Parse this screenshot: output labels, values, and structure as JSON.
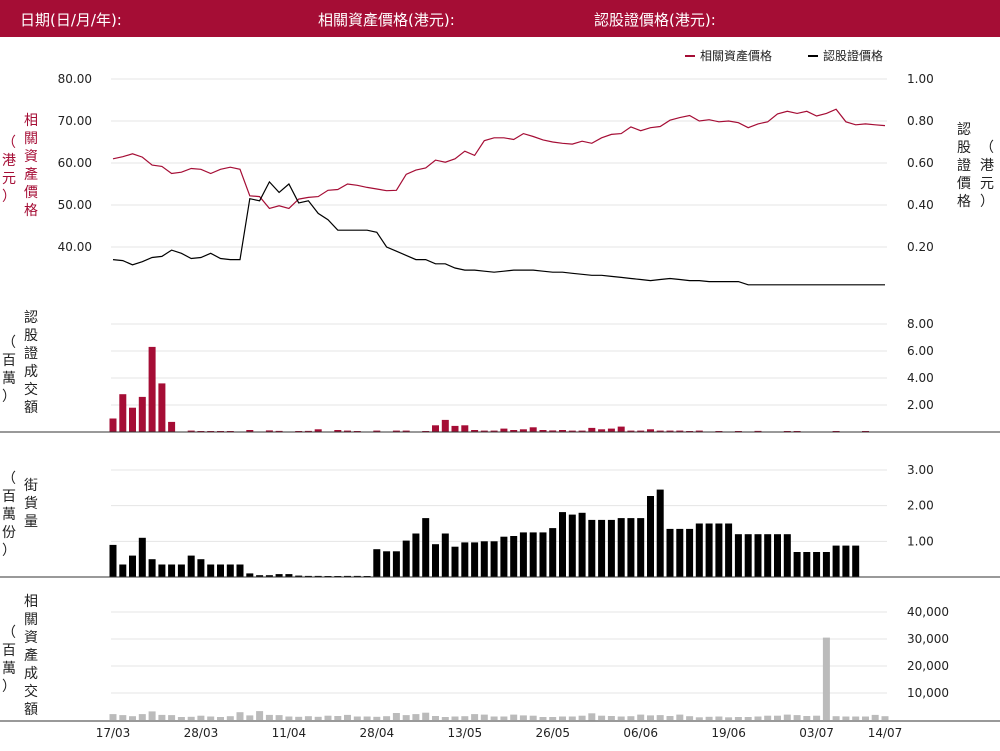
{
  "header": {
    "date_label": "日期(日/月/年):",
    "underlying_price_label": "相關資產價格(港元):",
    "warrant_price_label": "認股證價格(港元):"
  },
  "colors": {
    "header_bg": "#a50d35",
    "underlying": "#a50d35",
    "warrant": "#000000",
    "underlying_turnover": "#bbbbbb"
  },
  "chart_data": [
    {
      "type": "line",
      "legend": [
        "相關資產價格",
        "認股證價格"
      ],
      "legend_position": "top-right",
      "left_axis_label": [
        "相",
        "關",
        "資",
        "產",
        "價",
        "格"
      ],
      "left_axis_unit": [
        "（",
        "港",
        "元",
        "）"
      ],
      "right_axis_label": [
        "認",
        "股",
        "證",
        "價",
        "格"
      ],
      "right_axis_unit": [
        "（",
        "港",
        "元",
        "）"
      ],
      "left_ticks": [
        "80.00",
        "70.00",
        "60.00",
        "50.00",
        "40.00"
      ],
      "right_ticks": [
        "1.00",
        "0.80",
        "0.60",
        "0.40",
        "0.20"
      ],
      "left_ylim": [
        33.5,
        80
      ],
      "right_ylim": [
        0.01,
        1.0
      ],
      "x_count": 80,
      "series": [
        {
          "name": "相關資產價格",
          "axis": "left",
          "values": [
            61,
            61.5,
            62.2,
            61.4,
            59.5,
            59.2,
            57.5,
            57.8,
            58.7,
            58.5,
            57.5,
            58.5,
            59,
            58.5,
            52.2,
            52,
            49.2,
            49.8,
            49.2,
            51.4,
            51.8,
            52,
            53.5,
            53.7,
            55,
            54.7,
            54.2,
            53.8,
            53.4,
            53.5,
            57.3,
            58.3,
            58.8,
            60.7,
            60.2,
            61,
            62.8,
            61.8,
            65.3,
            66,
            66,
            65.6,
            67,
            66.3,
            65.5,
            65,
            64.7,
            64.5,
            65.2,
            64.7,
            66,
            66.8,
            67,
            68.6,
            67.7,
            68.4,
            68.7,
            70.2,
            70.8,
            71.3,
            70,
            70.3,
            69.8,
            70,
            69.6,
            68.4,
            69.3,
            69.8,
            71.7,
            72.3,
            71.8,
            72.3,
            71.2,
            71.8,
            72.8,
            69.8,
            69.1,
            69.3,
            69.1,
            68.9
          ]
        },
        {
          "name": "認股證價格",
          "axis": "right",
          "values": [
            0.14,
            0.135,
            0.115,
            0.13,
            0.15,
            0.155,
            0.185,
            0.17,
            0.145,
            0.15,
            0.17,
            0.145,
            0.14,
            0.14,
            0.43,
            0.42,
            0.51,
            0.46,
            0.5,
            0.41,
            0.42,
            0.36,
            0.33,
            0.28,
            0.28,
            0.28,
            0.28,
            0.27,
            0.2,
            0.18,
            0.16,
            0.14,
            0.14,
            0.12,
            0.12,
            0.1,
            0.09,
            0.09,
            0.085,
            0.08,
            0.085,
            0.09,
            0.09,
            0.09,
            0.085,
            0.08,
            0.08,
            0.075,
            0.07,
            0.065,
            0.065,
            0.06,
            0.055,
            0.05,
            0.045,
            0.04,
            0.045,
            0.05,
            0.045,
            0.04,
            0.04,
            0.035,
            0.035,
            0.035,
            0.035,
            0.02,
            0.02,
            0.02,
            0.02,
            0.02,
            0.02,
            0.02,
            0.02,
            0.02,
            0.02,
            0.02,
            0.02,
            0.02,
            0.02,
            0.02
          ]
        }
      ]
    },
    {
      "type": "bar",
      "axis_label": [
        "認",
        "股",
        "證",
        "成",
        "交",
        "額"
      ],
      "axis_unit": [
        "（",
        "百",
        "萬",
        "）"
      ],
      "ticks": [
        "8.00",
        "6.00",
        "4.00",
        "2.00"
      ],
      "ylim": [
        0,
        8.5
      ],
      "color": "#a50d35",
      "values": [
        1.0,
        2.8,
        1.8,
        2.6,
        6.3,
        3.6,
        0.75,
        0,
        0.1,
        0.05,
        0.05,
        0.05,
        0.05,
        0,
        0.15,
        0,
        0.12,
        0.08,
        0,
        0.05,
        0.08,
        0.2,
        0,
        0.15,
        0.1,
        0.05,
        0,
        0.1,
        0,
        0.1,
        0.1,
        0,
        0.05,
        0.5,
        0.9,
        0.45,
        0.5,
        0.15,
        0.1,
        0.1,
        0.25,
        0.15,
        0.2,
        0.35,
        0.15,
        0.12,
        0.15,
        0.1,
        0.1,
        0.3,
        0.2,
        0.25,
        0.4,
        0.1,
        0.1,
        0.2,
        0.1,
        0.1,
        0.1,
        0.05,
        0.1,
        0,
        0.05,
        0,
        0.05,
        0,
        0.08,
        0,
        0,
        0.05,
        0.05,
        0,
        0,
        0,
        0.05,
        0,
        0,
        0.05,
        0,
        0
      ]
    },
    {
      "type": "bar",
      "axis_label": [
        "街",
        "貨",
        "量"
      ],
      "axis_unit": [
        "（",
        "百",
        "萬",
        "份",
        "）"
      ],
      "ticks": [
        "3.00",
        "2.00",
        "1.00"
      ],
      "ylim": [
        0,
        3.2
      ],
      "color": "#000000",
      "values": [
        0.9,
        0.35,
        0.6,
        1.1,
        0.5,
        0.35,
        0.35,
        0.35,
        0.6,
        0.5,
        0.35,
        0.35,
        0.35,
        0.35,
        0.1,
        0.05,
        0.05,
        0.08,
        0.08,
        0.04,
        0.03,
        0.03,
        0.01,
        0.01,
        0.03,
        0.03,
        0.01,
        0.78,
        0.72,
        0.72,
        1.02,
        1.22,
        1.65,
        0.92,
        1.22,
        0.85,
        0.97,
        0.97,
        1.0,
        1.0,
        1.13,
        1.15,
        1.25,
        1.25,
        1.25,
        1.37,
        1.82,
        1.75,
        1.8,
        1.6,
        1.6,
        1.6,
        1.65,
        1.65,
        1.65,
        2.27,
        2.45,
        1.35,
        1.35,
        1.35,
        1.5,
        1.5,
        1.5,
        1.5,
        1.2,
        1.2,
        1.2,
        1.2,
        1.2,
        1.2,
        0.7,
        0.7,
        0.7,
        0.7,
        0.88,
        0.88,
        0.88,
        0,
        0,
        0
      ]
    },
    {
      "type": "bar",
      "axis_label": [
        "相",
        "關",
        "資",
        "產",
        "成",
        "交",
        "額"
      ],
      "axis_unit": [
        "（",
        "百",
        "萬",
        "）"
      ],
      "ticks": [
        "40,000",
        "30,000",
        "20,000",
        "10,000"
      ],
      "ylim": [
        0,
        42000
      ],
      "color": "#bbbbbb",
      "x_ticks": [
        "17/03",
        "28/03",
        "11/04",
        "28/04",
        "13/05",
        "26/05",
        "06/06",
        "19/06",
        "03/07",
        "14/07"
      ],
      "values": [
        2200,
        1800,
        1400,
        2200,
        3200,
        1900,
        1800,
        1100,
        1200,
        1600,
        1300,
        1100,
        1400,
        2900,
        1700,
        3300,
        1900,
        1800,
        1300,
        1200,
        1400,
        1200,
        1600,
        1500,
        1900,
        1300,
        1300,
        1200,
        1400,
        2600,
        1800,
        2200,
        2700,
        1500,
        1100,
        1300,
        1400,
        2200,
        2000,
        1300,
        1300,
        2000,
        1700,
        1600,
        1100,
        1100,
        1300,
        1300,
        1600,
        2500,
        1600,
        1500,
        1300,
        1400,
        2000,
        1700,
        1800,
        1500,
        2000,
        1400,
        1000,
        1200,
        1300,
        1000,
        1100,
        1100,
        1300,
        1600,
        1600,
        2000,
        1800,
        1500,
        1600,
        30500,
        1400,
        1300,
        1300,
        1300,
        1900,
        1400
      ]
    }
  ]
}
